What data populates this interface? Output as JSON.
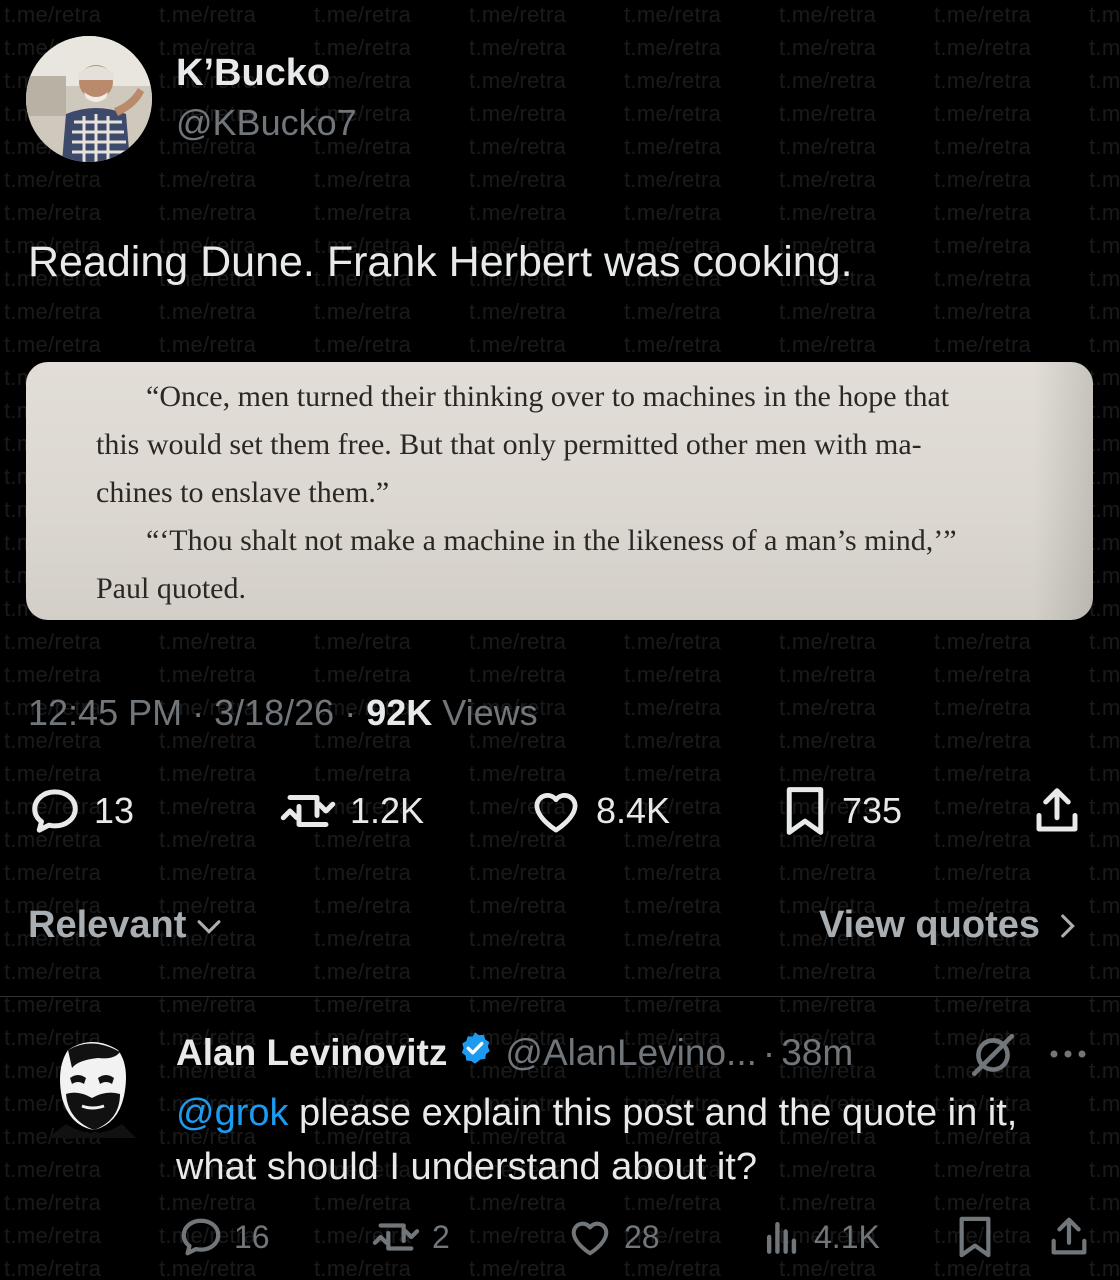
{
  "watermark": {
    "text": "t.me/retra"
  },
  "post": {
    "author_name": "K’Bucko",
    "author_handle": "@KBucko7",
    "text": "Reading Dune. Frank Herbert was cooking.",
    "image_lines": [
      "“Once, men turned their thinking over to machines in the hope that",
      "this would set them free. But that only permitted other men with ma-",
      "chines to enslave them.”",
      "“‘Thou shalt not make a machine in the likeness of a man’s mind,’”",
      "Paul quoted."
    ],
    "time": "12:45 PM",
    "separator": " · ",
    "date": "3/18/26",
    "views_count": "92K",
    "views_label": "Views",
    "actions": {
      "replies": "13",
      "reposts": "1.2K",
      "likes": "8.4K",
      "bookmarks": "735"
    }
  },
  "sort": {
    "label": "Relevant",
    "view_quotes": "View quotes"
  },
  "reply": {
    "author_name": "Alan Levinovitz",
    "author_handle": "@AlanLevino...",
    "separator": "·",
    "time": "38m",
    "mention": "@grok",
    "text": " please explain this post and the quote in it, what should I understand about it?",
    "actions": {
      "replies": "16",
      "reposts": "2",
      "likes": "28",
      "views": "4.1K"
    }
  },
  "colors": {
    "background": "#000000",
    "text_primary": "#e7e9ea",
    "text_secondary": "#71767b",
    "accent_blue": "#1d9bf0",
    "page_paper": "#dedad3"
  }
}
